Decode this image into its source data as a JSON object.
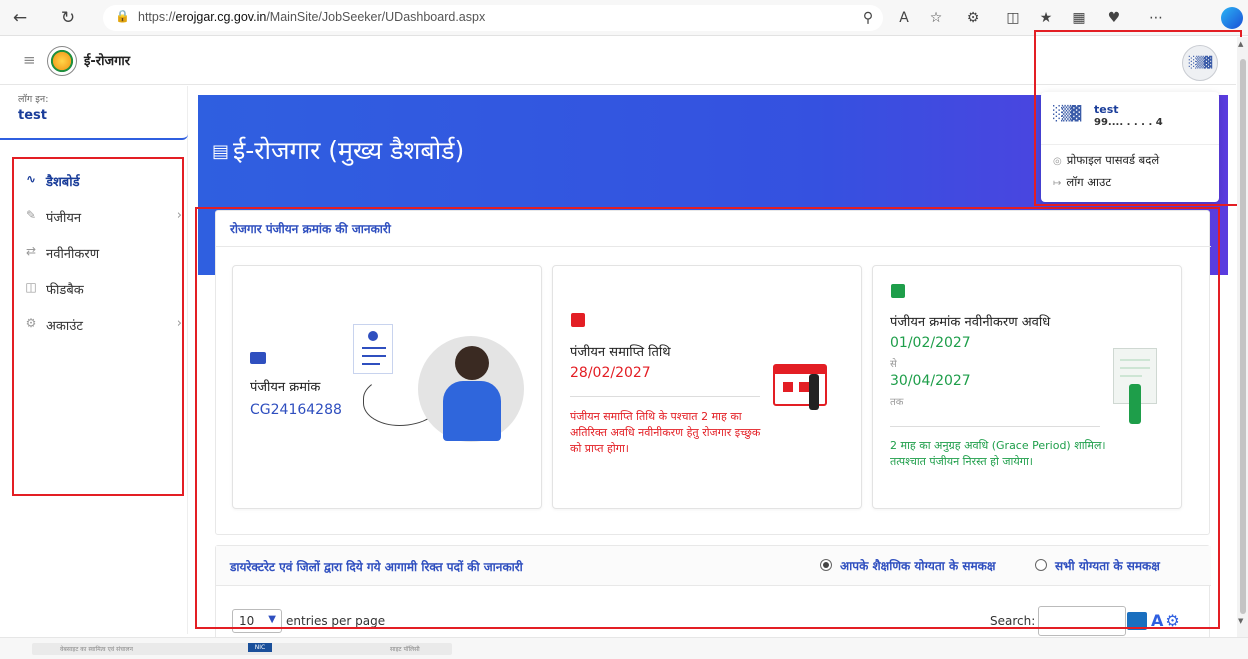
{
  "browser": {
    "url_prefix": "https://",
    "url_domain": "erojgar.cg.gov.in",
    "url_path": "/MainSite/JobSeeker/UDashboard.aspx"
  },
  "header": {
    "app_name": "ई-रोजगार"
  },
  "sidebar": {
    "login_label": "लॉग इन:",
    "login_user": "test",
    "items": [
      {
        "label": "डैशबोर्ड",
        "icon": "activity-icon",
        "active": true
      },
      {
        "label": "पंजीयन",
        "icon": "edit-icon",
        "has_submenu": true
      },
      {
        "label": "नवीनीकरण",
        "icon": "refresh-icon"
      },
      {
        "label": "फीडबैक",
        "icon": "book-icon"
      },
      {
        "label": "अकाउंट",
        "icon": "gear-icon",
        "has_submenu": true
      }
    ]
  },
  "banner": {
    "title": "ई-रोजगार (मुख्य डैशबोर्ड)"
  },
  "profile_menu": {
    "name": "test",
    "phone": "99....",
    "phone_suffix": "4",
    "change_password": "प्रोफाइल पासवर्ड बदले",
    "logout": "लॉग आउट"
  },
  "registration_panel": {
    "title": "रोजगार पंजीयन क्रमांक की जानकारी",
    "card1": {
      "label": "पंजीयन क्रमांक",
      "value": "CG24164288"
    },
    "card2": {
      "label": "पंजीयन समाप्ति तिथि",
      "date": "28/02/2027",
      "note": "पंजीयन समाप्ति तिथि के पश्चात 2 माह का अतिरिक्त अवधि नवीनीकरण हेतु रोजगार इच्छुक को प्राप्त होगा।"
    },
    "card3": {
      "label": "पंजीयन क्रमांक नवीनीकरण अवधि",
      "from_date": "01/02/2027",
      "from_word": "से",
      "to_date": "30/04/2027",
      "to_word": "तक",
      "note": "2 माह का अनुग्रह अवधि (Grace Period) शामिल। तत्पश्चात पंजीयन निरस्त हो जायेगा।"
    }
  },
  "vacancies_panel": {
    "title": "डायरेक्टरेट एवं जिलों द्वारा दिये गये आगामी रिक्त पदों की जानकारी",
    "option_selected": "आपके शैक्षणिक योग्यता के समकक्ष",
    "option_other": "सभी योग्यता के समकक्ष",
    "entries_value": "10",
    "entries_label": "entries per page",
    "search_label": "Search:",
    "search_value": ""
  },
  "footer": {
    "left_text": "वेबसाइट का स्वामित्व एवं संचालन",
    "nic_badge": "NIC",
    "right_text": "साइट पॉलिसी"
  },
  "colors": {
    "primary_blue": "#2f5fe0",
    "danger_red": "#e31e24",
    "success_green": "#1e9e4a",
    "highlight_frame": "#e31e24"
  }
}
